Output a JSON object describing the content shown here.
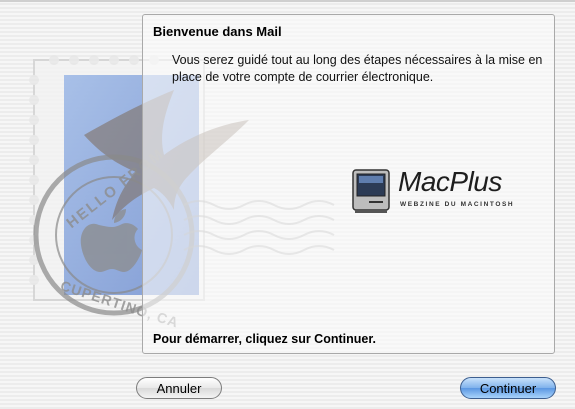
{
  "window": {
    "panel_title": "Bienvenue dans Mail",
    "panel_description": "Vous serez guidé tout au long des étapes nécessaires à la mise en place de votre compte de courrier électronique.",
    "panel_footer": "Pour démarrer, cliquez sur Continuer."
  },
  "stamp": {
    "text_top": "HELLO FROM",
    "text_bottom": "CUPERTINO, CA"
  },
  "logo": {
    "name": "MacPlus",
    "tagline": "WEBZINE DU MACINTOSH"
  },
  "buttons": {
    "cancel_label": "Annuler",
    "continue_label": "Continuer"
  },
  "colors": {
    "accent_button": "#6fa6e9",
    "stamp_blue": "#7f9fd6"
  }
}
